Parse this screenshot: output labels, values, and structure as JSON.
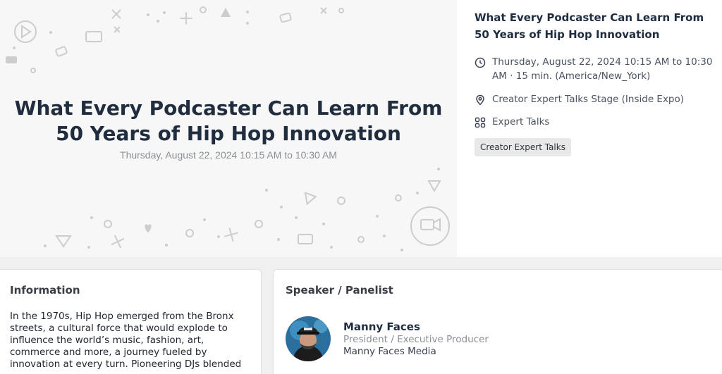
{
  "hero": {
    "title": "What Every Podcaster Can Learn From 50 Years of Hip Hop Innovation",
    "date": "Thursday, August 22, 2024 10:15 AM to 10:30 AM"
  },
  "details": {
    "title": "What Every Podcaster Can Learn From 50 Years of Hip Hop Innovation",
    "datetime": "Thursday, August 22, 2024 10:15 AM to 10:30 AM · 15 min. (America/New_York)",
    "location": "Creator Expert Talks Stage (Inside Expo)",
    "track": "Expert Talks",
    "tag": "Creator Expert Talks",
    "icons": {
      "clock": "clock-icon",
      "location": "map-pin-icon",
      "track": "grid-icon"
    }
  },
  "information": {
    "heading": "Information",
    "text": "In the 1970s, Hip Hop emerged from the Bronx streets, a cultural force that would explode to influence the world’s music, fashion, art, commerce and more, a journey fueled by innovation at every turn. Pioneering DJs blended"
  },
  "speakers": {
    "heading": "Speaker / Panelist",
    "items": [
      {
        "name": "Manny Faces",
        "role": "President / Executive Producer",
        "org": "Manny Faces Media"
      }
    ]
  },
  "colors": {
    "heading": "#1f2d3f",
    "muted": "#8a8f96",
    "decor": "#c8c8c8"
  }
}
